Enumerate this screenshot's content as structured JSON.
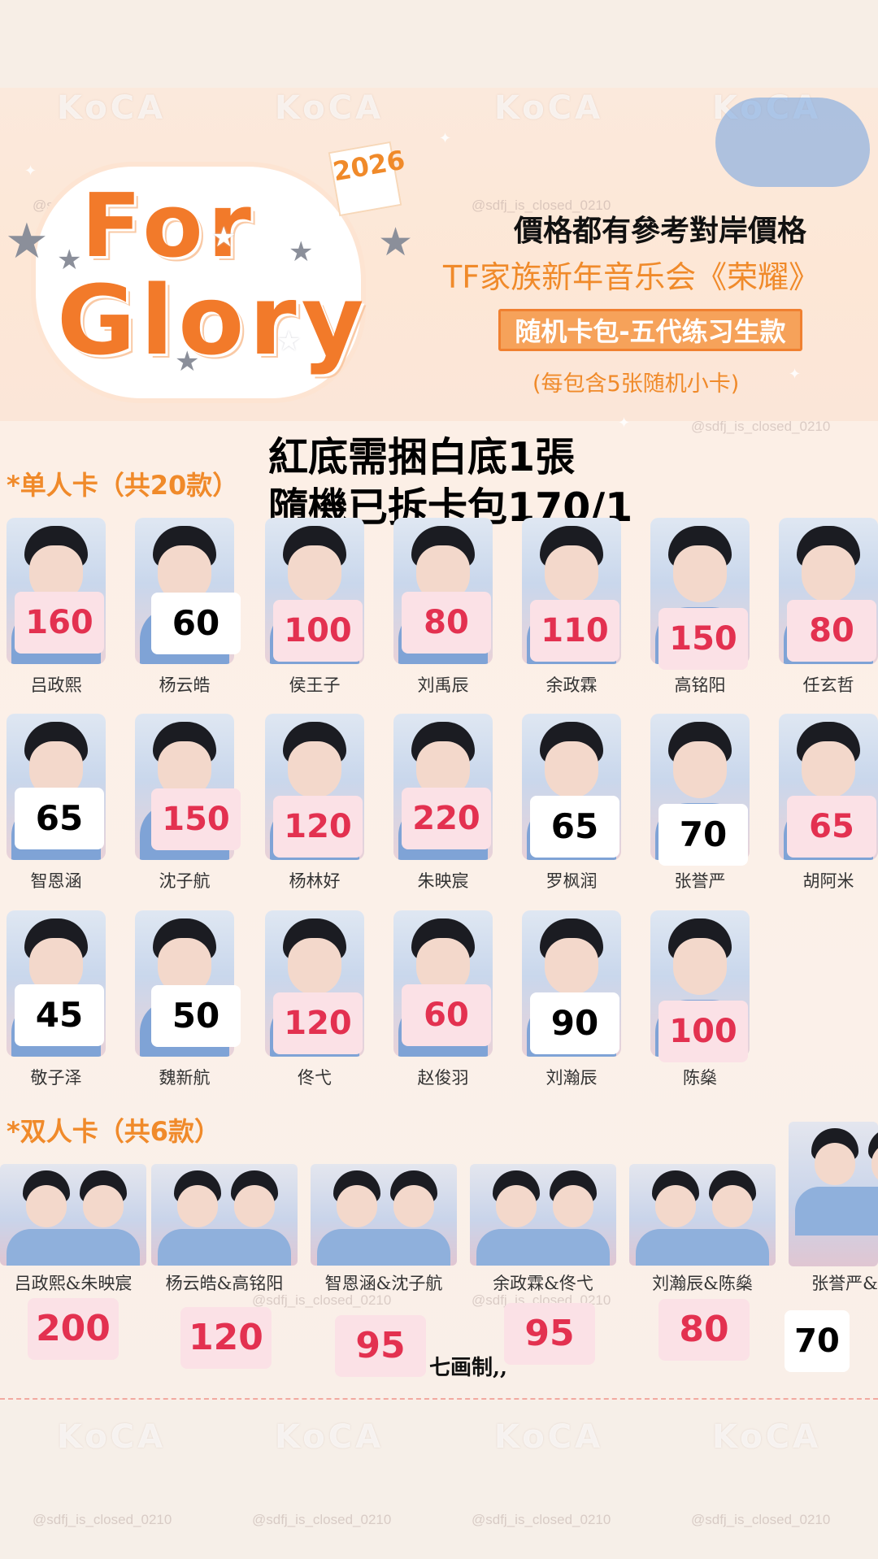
{
  "watermarks": {
    "logo": "KoCA",
    "handle": "@sdfj_is_closed_0210"
  },
  "header": {
    "logo_line1": "For",
    "logo_line2": "Glory",
    "year": "2026",
    "price_note": "價格都有參考對岸價格",
    "concert_title": "TF家族新年音乐会《荣耀》",
    "pack_banner": "随机卡包-五代练习生款",
    "pack_note": "(每包含5张随机小卡)"
  },
  "notice": {
    "line1": "紅底需捆白底1張",
    "line2": "隨機已拆卡包170/1"
  },
  "single_section": {
    "title": "*单人卡（共20款）",
    "cards": [
      {
        "name": "吕政熙",
        "price": "160",
        "style": "pink"
      },
      {
        "name": "杨云皓",
        "price": "60",
        "style": "white"
      },
      {
        "name": "侯王子",
        "price": "100",
        "style": "pink"
      },
      {
        "name": "刘禹辰",
        "price": "80",
        "style": "pink"
      },
      {
        "name": "余政霖",
        "price": "110",
        "style": "pink"
      },
      {
        "name": "高铭阳",
        "price": "150",
        "style": "pink"
      },
      {
        "name": "任玄哲",
        "price": "80",
        "style": "pink"
      },
      {
        "name": "智恩涵",
        "price": "65",
        "style": "white"
      },
      {
        "name": "沈子航",
        "price": "150",
        "style": "pink"
      },
      {
        "name": "杨林好",
        "price": "120",
        "style": "pink"
      },
      {
        "name": "朱映宸",
        "price": "220",
        "style": "pink"
      },
      {
        "name": "罗枫润",
        "price": "65",
        "style": "white"
      },
      {
        "name": "张誉严",
        "price": "70",
        "style": "white"
      },
      {
        "name": "胡阿米",
        "price": "65",
        "style": "pink"
      },
      {
        "name": "敬子泽",
        "price": "45",
        "style": "white"
      },
      {
        "name": "魏新航",
        "price": "50",
        "style": "white"
      },
      {
        "name": "佟弋",
        "price": "120",
        "style": "pink"
      },
      {
        "name": "赵俊羽",
        "price": "60",
        "style": "pink"
      },
      {
        "name": "刘瀚辰",
        "price": "90",
        "style": "white"
      },
      {
        "name": "陈燊",
        "price": "100",
        "style": "pink"
      }
    ]
  },
  "pair_section": {
    "title": "*双人卡（共6款）",
    "cards": [
      {
        "name": "吕政熙&朱映宸",
        "price": "200",
        "style": "pink"
      },
      {
        "name": "杨云皓&高铭阳",
        "price": "120",
        "style": "pink"
      },
      {
        "name": "智恩涵&沈子航",
        "price": "95",
        "style": "pink"
      },
      {
        "name": "余政霖&佟弋",
        "price": "95",
        "style": "pink"
      },
      {
        "name": "刘瀚辰&陈燊",
        "price": "80",
        "style": "pink"
      },
      {
        "name": "张誉严&魏新",
        "price": "70",
        "style": "white"
      }
    ]
  },
  "credit": "七画制,,"
}
